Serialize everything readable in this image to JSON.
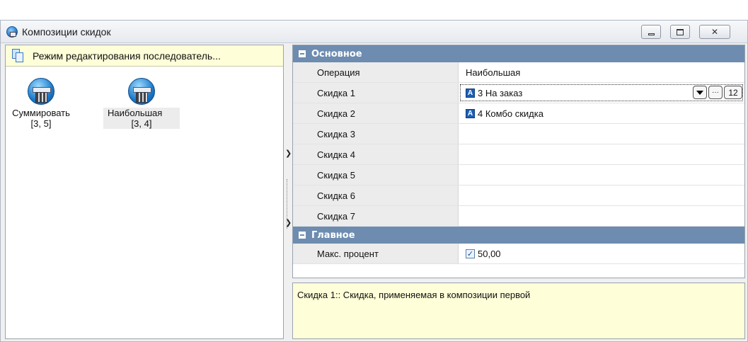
{
  "window": {
    "title": "Композиции скидок",
    "controls": {
      "minimize": "minimize-icon",
      "maximize": "maximize-icon",
      "close": "close-icon"
    }
  },
  "left_pane": {
    "mode_label": "Режим редактирования последователь...",
    "nodes": [
      {
        "label": "Суммировать",
        "sub": "[3, 5]",
        "icon": "calculator-icon",
        "selected": false
      },
      {
        "label": "Наибольшая",
        "sub": "[3, 4]",
        "icon": "calculator-icon",
        "selected": true
      }
    ]
  },
  "grid": {
    "categories": [
      {
        "title": "Основное",
        "rows": [
          {
            "name": "Операция",
            "value": ""
          },
          {
            "name": "Скидка 1",
            "value": "3 На заказ",
            "badge": "А",
            "buttons": [
              "▾",
              "···",
              "12"
            ]
          },
          {
            "name": "Скидка 2",
            "value": "4 Комбо скидка",
            "badge": "А"
          },
          {
            "name": "Скидка 3",
            "value": ""
          },
          {
            "name": "Скидка 4",
            "value": ""
          },
          {
            "name": "Скидка 5",
            "value": ""
          },
          {
            "name": "Скидка 6",
            "value": ""
          },
          {
            "name": "Скидка 7",
            "value": ""
          }
        ]
      },
      {
        "title": "Главное",
        "rows": [
          {
            "name": "Макс. процент",
            "value": "50,00",
            "checked": true
          }
        ]
      }
    ],
    "operation_value": "Наибольшая"
  },
  "description": "Скидка 1:: Скидка, применяемая в композиции первой",
  "colors": {
    "category_bg": "#6d8cb0",
    "description_bg": "#fefed8",
    "badge_blue": "#1d5fb8"
  }
}
